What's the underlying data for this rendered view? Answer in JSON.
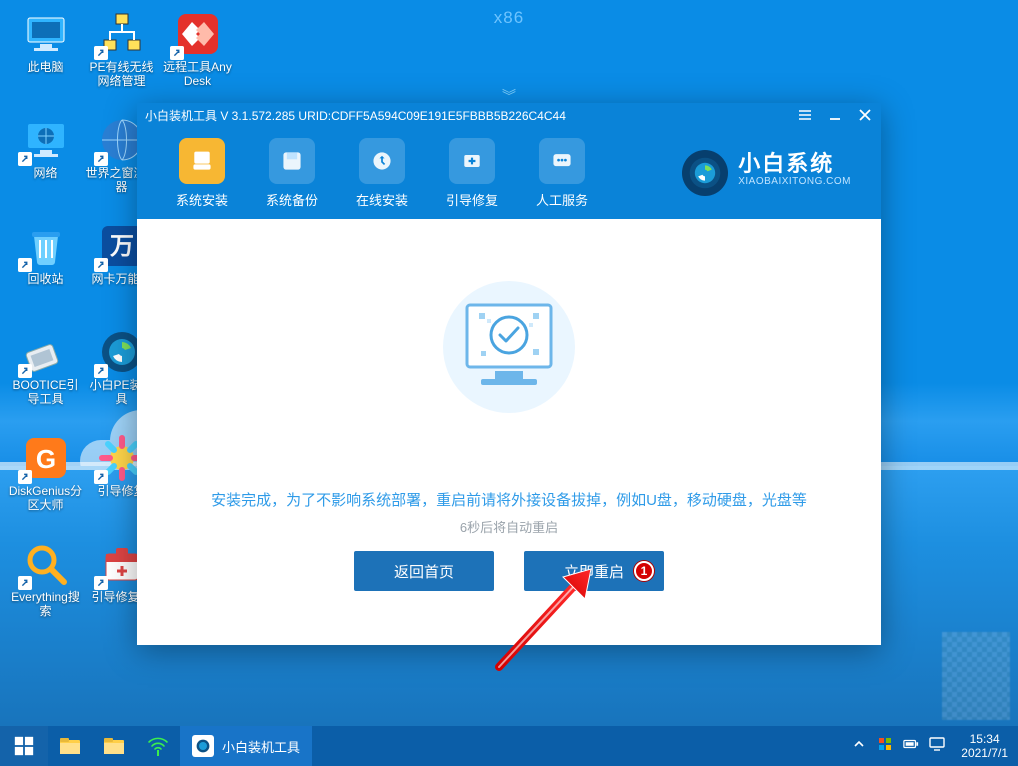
{
  "arch_label": "x86",
  "desktop_icons": [
    {
      "label": "此电脑",
      "name": "this-pc",
      "col": 0,
      "row": 0,
      "icon": "pc"
    },
    {
      "label": "PE有线无线网络管理",
      "name": "pe-network",
      "col": 1,
      "row": 0,
      "icon": "net"
    },
    {
      "label": "远程工具AnyDesk",
      "name": "anydesk",
      "col": 2,
      "row": 0,
      "icon": "anydesk"
    },
    {
      "label": "网络",
      "name": "network",
      "col": 0,
      "row": 1,
      "icon": "globe"
    },
    {
      "label": "世界之窗浏览器",
      "name": "theworld-browser",
      "col": 1,
      "row": 1,
      "icon": "world"
    },
    {
      "label": "回收站",
      "name": "recycle-bin",
      "col": 0,
      "row": 2,
      "icon": "bin"
    },
    {
      "label": "网卡万能驱",
      "name": "nic-driver",
      "col": 1,
      "row": 2,
      "icon": "wan"
    },
    {
      "label": "BOOTICE引导工具",
      "name": "bootice",
      "col": 0,
      "row": 3,
      "icon": "bootice"
    },
    {
      "label": "小白PE装机具",
      "name": "xiaobai-pe",
      "col": 1,
      "row": 3,
      "icon": "xb"
    },
    {
      "label": "DiskGenius分区大师",
      "name": "diskgenius",
      "col": 0,
      "row": 4,
      "icon": "dg"
    },
    {
      "label": "引导修复",
      "name": "boot-repair",
      "col": 1,
      "row": 4,
      "icon": "repair"
    },
    {
      "label": "Everything搜索",
      "name": "everything",
      "col": 0,
      "row": 5,
      "icon": "ev"
    },
    {
      "label": "引导修复工",
      "name": "boot-repair-tool",
      "col": 1,
      "row": 5,
      "icon": "repair2"
    }
  ],
  "window": {
    "title": "小白装机工具 V 3.1.572.285 URID:CDFF5A594C09E191E5FBBB5B226C4C44",
    "tabs": [
      {
        "label": "系统安装",
        "name": "tab-install",
        "active": true
      },
      {
        "label": "系统备份",
        "name": "tab-backup",
        "active": false
      },
      {
        "label": "在线安装",
        "name": "tab-online",
        "active": false
      },
      {
        "label": "引导修复",
        "name": "tab-bootfix",
        "active": false
      },
      {
        "label": "人工服务",
        "name": "tab-support",
        "active": false
      }
    ],
    "brand": {
      "title": "小白系统",
      "subtitle": "XIAOBAIXITONG.COM"
    },
    "message": "安装完成，为了不影响系统部署，重启前请将外接设备拔掉，例如U盘，移动硬盘，光盘等",
    "countdown": "6秒后将自动重启",
    "buttons": {
      "back": "返回首页",
      "restart": "立即重启"
    },
    "step_badge": "1"
  },
  "taskbar": {
    "app_label": "小白装机工具",
    "clock_time": "15:34",
    "clock_date": "2021/7/1"
  }
}
